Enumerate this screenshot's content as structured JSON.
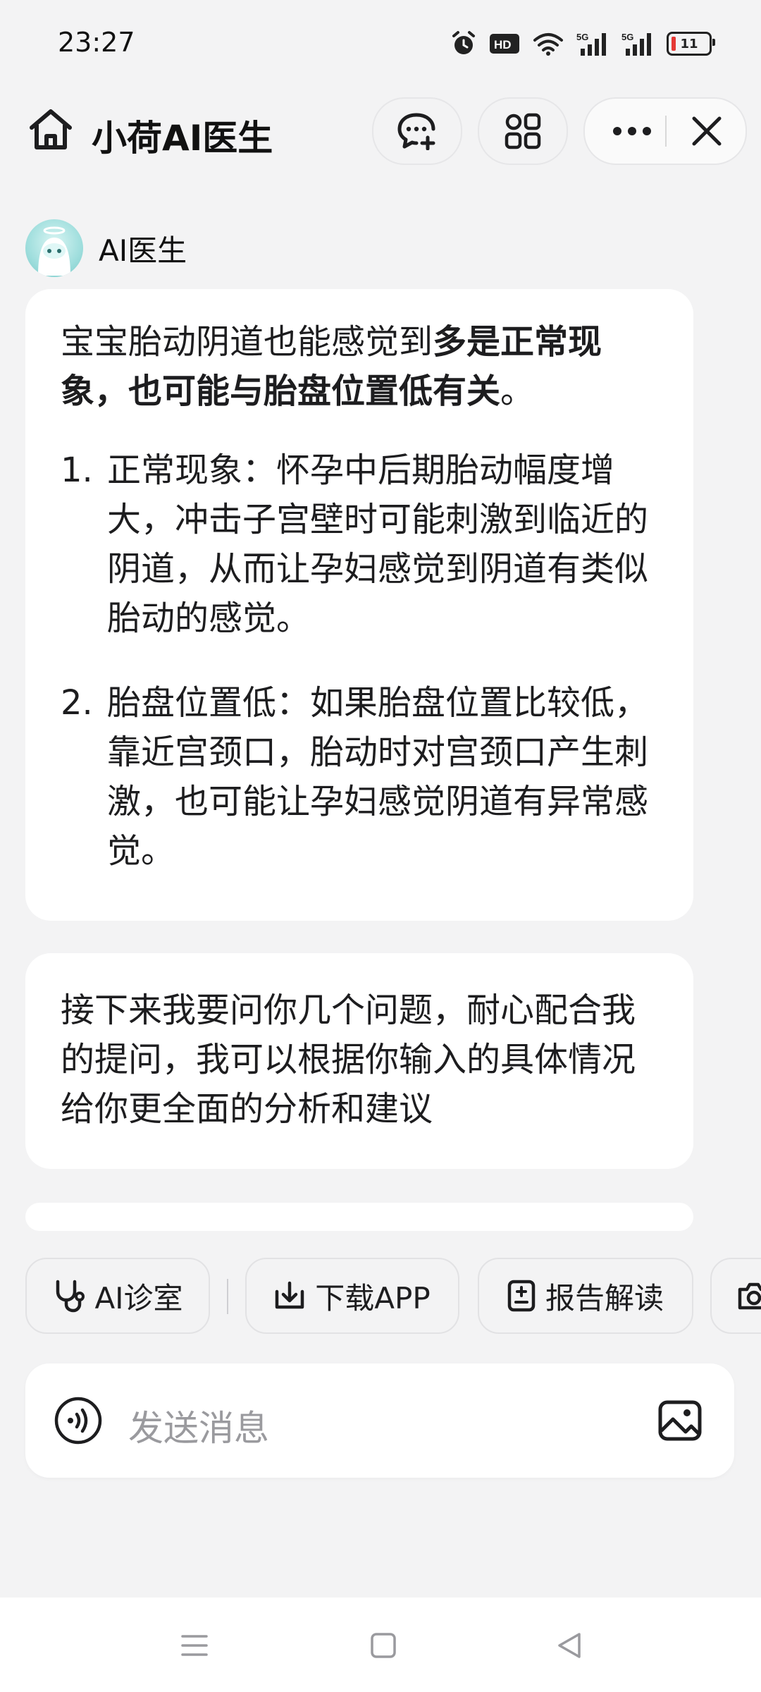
{
  "status_bar": {
    "time": "23:27",
    "battery_level": "11",
    "icons": [
      "alarm-icon",
      "hd-icon",
      "wifi-icon",
      "5g-signal-icon",
      "5g-signal-icon",
      "battery-icon"
    ]
  },
  "top_bar": {
    "title": "小荷AI医生",
    "buttons": [
      "home-icon",
      "new-chat-icon",
      "apps-grid-icon",
      "more-icon",
      "close-icon"
    ]
  },
  "bot": {
    "name": "AI医生"
  },
  "messages": {
    "first": {
      "lead_normal": "宝宝胎动阴道也能感觉到",
      "lead_bold": "多是正常现象，也可能与胎盘位置低有关",
      "lead_end": "。",
      "items": [
        {
          "num": "1.",
          "text": "正常现象：怀孕中后期胎动幅度增大，冲击子宫壁时可能刺激到临近的阴道，从而让孕妇感觉到阴道有类似胎动的感觉。"
        },
        {
          "num": "2.",
          "text": "胎盘位置低：如果胎盘位置比较低，靠近宫颈口，胎动时对宫颈口产生刺激，也可能让孕妇感觉阴道有异常感觉。"
        }
      ]
    },
    "second": {
      "text": "接下来我要问你几个问题，耐心配合我的提问，我可以根据你输入的具体情况给你更全面的分析和建议"
    }
  },
  "quick_actions": [
    {
      "label": "AI诊室",
      "icon": "stethoscope-icon"
    },
    {
      "label": "下载APP",
      "icon": "download-icon"
    },
    {
      "label": "报告解读",
      "icon": "report-icon"
    },
    {
      "label": "",
      "icon": "camera-icon"
    }
  ],
  "input": {
    "placeholder": "发送消息"
  },
  "colors": {
    "background": "#f3f3f4",
    "card": "#ffffff",
    "text": "#1d1d1f",
    "placeholder": "#9a9a9e",
    "avatar": "#9fdedd"
  }
}
